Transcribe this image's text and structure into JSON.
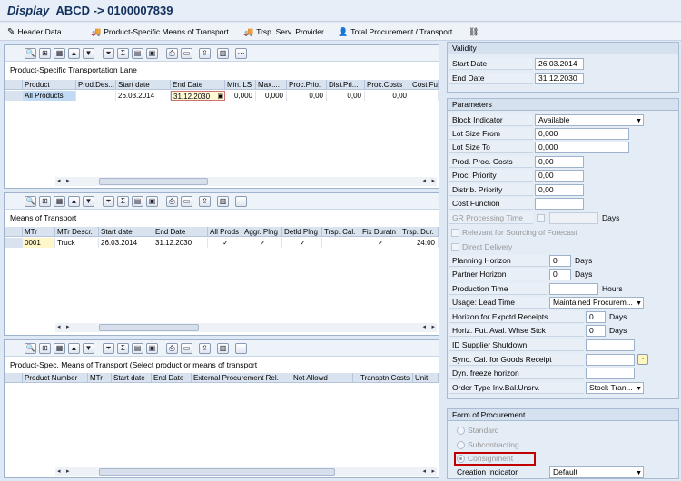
{
  "title": {
    "main": "Display",
    "sub": "ABCD -> 0100007839"
  },
  "toolbar": {
    "header_data": "Header Data",
    "ps_means": "Product-Specific Means of Transport",
    "trsp_serv": "Trsp. Serv. Provider",
    "total_proc": "Total Procurement / Transport"
  },
  "lane_grid": {
    "title": "Product-Specific Transportation Lane",
    "columns": [
      "Product",
      "Prod.Des...",
      "Start date",
      "End Date",
      "Min. LS",
      "Max....",
      "Proc.Prio.",
      "Dist.Pri...",
      "Proc.Costs",
      "Cost Fu"
    ],
    "row": [
      "All Products",
      "",
      "26.03.2014",
      "31.12.2030",
      "0,000",
      "0,000",
      "0,00",
      "0,00",
      "0,00",
      ""
    ]
  },
  "means_grid": {
    "title": "Means of Transport",
    "columns": [
      "MTr",
      "MTr Descr.",
      "Start date",
      "End Date",
      "All Prods",
      "Aggr. Plng",
      "Detld Plng",
      "Trsp. Cal.",
      "Fix Duratn",
      "Trsp. Dur."
    ],
    "row": [
      "0001",
      "Truck",
      "26.03.2014",
      "31.12.2030",
      "✓",
      "✓",
      "✓",
      "",
      "✓",
      "24:00"
    ]
  },
  "spec_grid": {
    "title": "Product-Spec. Means of Transport (Select product or means of transport",
    "columns": [
      "Product Number",
      "MTr",
      "Start date",
      "End Date",
      "External Procurement Rel.",
      "Not Allowd",
      "Transptn Costs",
      "Unit"
    ]
  },
  "validity": {
    "heading": "Validity",
    "start_label": "Start Date",
    "start_value": "26.03.2014",
    "end_label": "End Date",
    "end_value": "31.12.2030"
  },
  "parameters": {
    "heading": "Parameters",
    "block_indicator": {
      "label": "Block Indicator",
      "value": "Available"
    },
    "lot_from": {
      "label": "Lot Size From",
      "value": "0,000"
    },
    "lot_to": {
      "label": "Lot Size To",
      "value": "0,000"
    },
    "prod_costs": {
      "label": "Prod. Proc. Costs",
      "value": "0,00"
    },
    "proc_priority": {
      "label": "Proc. Priority",
      "value": "0,00"
    },
    "distrib_priority": {
      "label": "Distrib. Priority",
      "value": "0,00"
    },
    "cost_function": {
      "label": "Cost Function",
      "value": ""
    },
    "gr_time": {
      "label": "GR Processing Time",
      "unit": "Days"
    },
    "relevant_sourcing": "Relevant for Sourcing of Forecast",
    "direct_delivery": "Direct Delivery",
    "planning_horizon": {
      "label": "Planning Horizon",
      "value": "0",
      "unit": "Days"
    },
    "partner_horizon": {
      "label": "Partner Horizon",
      "value": "0",
      "unit": "Days"
    },
    "production_time": {
      "label": "Production Time",
      "unit": "Hours"
    },
    "usage_lead": {
      "label": "Usage: Lead Time",
      "value": "Maintained Procurem..."
    },
    "horizon_receipts": {
      "label": "Horizon for Expctd Receipts",
      "value": "0",
      "unit": "Days"
    },
    "horiz_fut": {
      "label": "Horiz. Fut. Aval. Whse Stck",
      "value": "0",
      "unit": "Days"
    },
    "id_supplier": {
      "label": "ID Supplier Shutdown"
    },
    "sync_cal": {
      "label": "Sync. Cal. for Goods Receipt"
    },
    "dyn_freeze": {
      "label": "Dyn. freeze horizon"
    },
    "order_type": {
      "label": "Order Type Inv.Bal.Unsrv.",
      "value": "Stock Tran..."
    }
  },
  "procurement": {
    "heading": "Form of Procurement",
    "standard": "Standard",
    "subcontracting": "Subcontracting",
    "consignment": "Consignment",
    "creation_label": "Creation Indicator",
    "creation_value": "Default",
    "highlight_color": "#c00000"
  }
}
